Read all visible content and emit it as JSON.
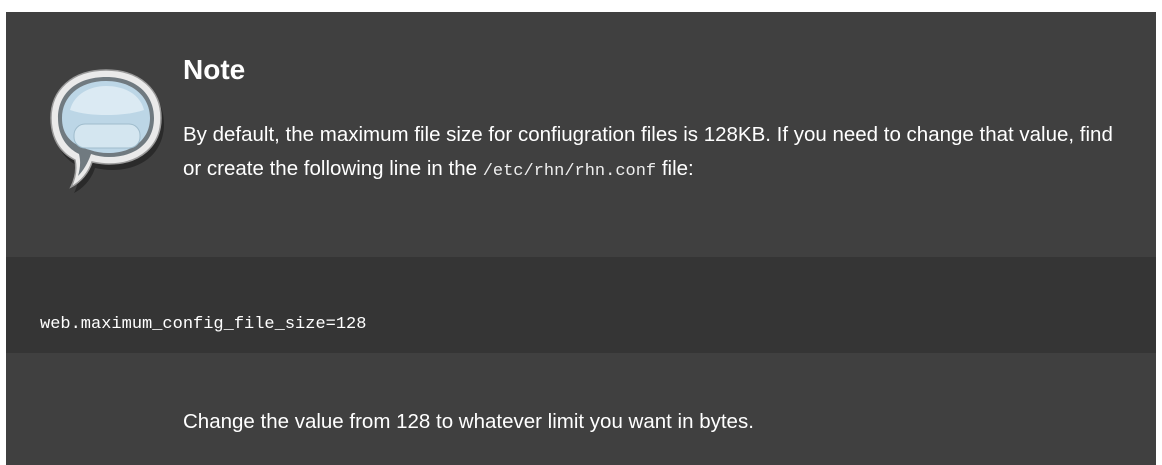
{
  "note": {
    "title": "Note",
    "para_before": "By default, the maximum file size for confiugration files is 128KB. If you need to change that value, find or create the following line in the ",
    "filename": "/etc/rhn/rhn.conf",
    "para_after": " file:",
    "code": "web.maximum_config_file_size=128",
    "followup": "Change the value from 128 to whatever limit you want in bytes.",
    "icon": "speech-bubble-icon"
  },
  "colors": {
    "box_background": "#404040",
    "code_background": "#353535",
    "text": "#ffffff",
    "bubble_fill": "#bcd6e6",
    "bubble_outline": "#eaeaea"
  }
}
